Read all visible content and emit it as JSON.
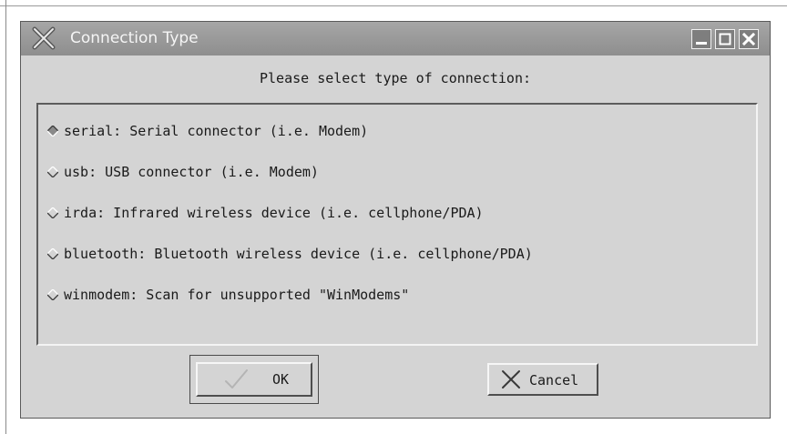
{
  "window": {
    "title": "Connection Type",
    "icon": "app-x-icon",
    "controls": [
      "minimize-icon",
      "maximize-icon",
      "close-icon"
    ]
  },
  "dialog": {
    "prompt": "Please select type of connection:",
    "options": [
      {
        "label": "serial: Serial connector (i.e. Modem)",
        "selected": true
      },
      {
        "label": "usb: USB connector (i.e. Modem)",
        "selected": false
      },
      {
        "label": "irda: Infrared wireless device (i.e. cellphone/PDA)",
        "selected": false
      },
      {
        "label": "bluetooth: Bluetooth wireless device (i.e. cellphone/PDA)",
        "selected": false
      },
      {
        "label": "winmodem: Scan for unsupported \"WinModems\"",
        "selected": false
      }
    ],
    "ok_label": "OK",
    "cancel_label": "Cancel"
  },
  "colors": {
    "titlebar": "#8e8e8e",
    "window_bg": "#d4d4d4",
    "text": "#1a1a1a"
  }
}
